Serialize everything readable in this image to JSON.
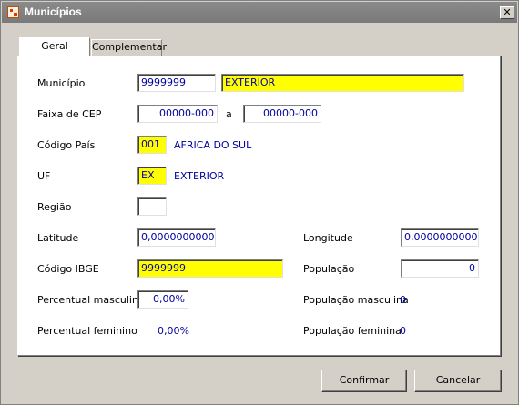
{
  "window": {
    "title": "Municípios",
    "close_label": "✕"
  },
  "tabs": [
    {
      "label": "Geral"
    },
    {
      "label": "Complementar"
    }
  ],
  "form": {
    "municipio": {
      "label": "Município",
      "code": "9999999",
      "name": "EXTERIOR"
    },
    "cep": {
      "label": "Faixa de CEP",
      "from": "00000-000",
      "sep": "a",
      "to": "00000-000"
    },
    "pais": {
      "label": "Código País",
      "code": "001",
      "name": "AFRICA DO SUL"
    },
    "uf": {
      "label": "UF",
      "code": "EX",
      "name": "EXTERIOR"
    },
    "regiao": {
      "label": "Região",
      "value": ""
    },
    "latitude": {
      "label": "Latitude",
      "value": "0,000000000000"
    },
    "longitude": {
      "label": "Longitude",
      "value": "0,000000000000"
    },
    "ibge": {
      "label": "Código IBGE",
      "value": "9999999"
    },
    "populacao": {
      "label": "População",
      "value": "0"
    },
    "perc_masc": {
      "label": "Percentual masculino",
      "value": "0,00%"
    },
    "pop_masc": {
      "label": "População masculina",
      "value": "0"
    },
    "perc_fem": {
      "label": "Percentual feminino",
      "value": "0,00%"
    },
    "pop_fem": {
      "label": "População feminina",
      "value": "0"
    }
  },
  "buttons": {
    "confirm": "Confirmar",
    "cancel": "Cancelar"
  },
  "colors": {
    "highlight": "#ffff00",
    "value_text": "#0000a0",
    "titlebar": "#808080"
  }
}
